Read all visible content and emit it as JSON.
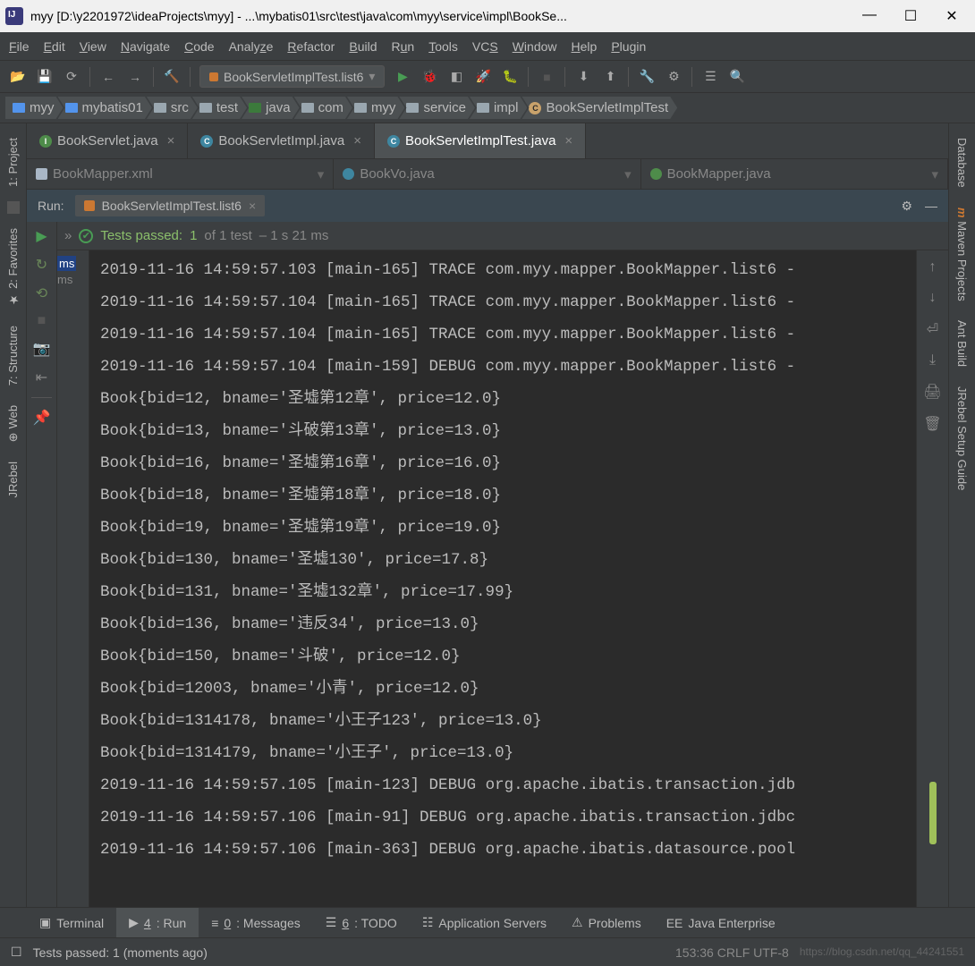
{
  "window": {
    "title": "myy [D:\\y2201972\\ideaProjects\\myy] - ...\\mybatis01\\src\\test\\java\\com\\myy\\service\\impl\\BookSe..."
  },
  "menu": [
    "File",
    "Edit",
    "View",
    "Navigate",
    "Code",
    "Analyze",
    "Refactor",
    "Build",
    "Run",
    "Tools",
    "VCS",
    "Window",
    "Help",
    "Plugin"
  ],
  "run_config": "BookServletImplTest.list6",
  "breadcrumbs": [
    "myy",
    "mybatis01",
    "src",
    "test",
    "java",
    "com",
    "myy",
    "service",
    "impl",
    "BookServletImplTest"
  ],
  "editor_tabs": [
    {
      "label": "BookServlet.java",
      "badge": "i",
      "active": false
    },
    {
      "label": "BookServletImpl.java",
      "badge": "c",
      "active": false
    },
    {
      "label": "BookServletImplTest.java",
      "badge": "t",
      "active": true
    }
  ],
  "editor_tabs2": [
    {
      "label": "BookMapper.xml"
    },
    {
      "label": "BookVo.java"
    },
    {
      "label": "BookMapper.java"
    }
  ],
  "run_panel": {
    "label": "Run:",
    "name": "BookServletImplTest.list6",
    "test_status": {
      "prefix": "Tests passed:",
      "count": "1",
      "of": "of 1 test",
      "time": "– 1 s 21 ms"
    }
  },
  "tree_badges": [
    "ms",
    "ms"
  ],
  "console_lines": [
    "2019-11-16 14:59:57.103 [main-165] TRACE com.myy.mapper.BookMapper.list6 -",
    "2019-11-16 14:59:57.104 [main-165] TRACE com.myy.mapper.BookMapper.list6 -",
    "2019-11-16 14:59:57.104 [main-165] TRACE com.myy.mapper.BookMapper.list6 -",
    "2019-11-16 14:59:57.104 [main-159] DEBUG com.myy.mapper.BookMapper.list6 -",
    "Book{bid=12, bname='圣墟第12章', price=12.0}",
    "Book{bid=13, bname='斗破第13章', price=13.0}",
    "Book{bid=16, bname='圣墟第16章', price=16.0}",
    "Book{bid=18, bname='圣墟第18章', price=18.0}",
    "Book{bid=19, bname='圣墟第19章', price=19.0}",
    "Book{bid=130, bname='圣墟130', price=17.8}",
    "Book{bid=131, bname='圣墟132章', price=17.99}",
    "Book{bid=136, bname='违反34', price=13.0}",
    "Book{bid=150, bname='斗破', price=12.0}",
    "Book{bid=12003, bname='小青', price=12.0}",
    "Book{bid=1314178, bname='小王子123', price=13.0}",
    "Book{bid=1314179, bname='小王子', price=13.0}",
    "2019-11-16 14:59:57.105 [main-123] DEBUG org.apache.ibatis.transaction.jdb",
    "2019-11-16 14:59:57.106 [main-91] DEBUG org.apache.ibatis.transaction.jdbc",
    "2019-11-16 14:59:57.106 [main-363] DEBUG org.apache.ibatis.datasource.pool"
  ],
  "left_tabs": [
    "1: Project",
    "2: Favorites",
    "7: Structure",
    "Web",
    "JRebel"
  ],
  "right_tabs": [
    "Database",
    "Maven Projects",
    "Ant Build",
    "JRebel Setup Guide"
  ],
  "bottom_tabs": [
    {
      "label": "Terminal",
      "active": false
    },
    {
      "label": "4: Run",
      "active": true
    },
    {
      "label": "0: Messages",
      "active": false
    },
    {
      "label": "6: TODO",
      "active": false
    },
    {
      "label": "Application Servers",
      "active": false
    },
    {
      "label": "Problems",
      "active": false
    },
    {
      "label": "Java Enterprise",
      "active": false
    }
  ],
  "status": {
    "left": "Tests passed: 1 (moments ago)",
    "right": "153:36   CRLF   UTF-8",
    "watermark": "https://blog.csdn.net/qq_44241551"
  }
}
